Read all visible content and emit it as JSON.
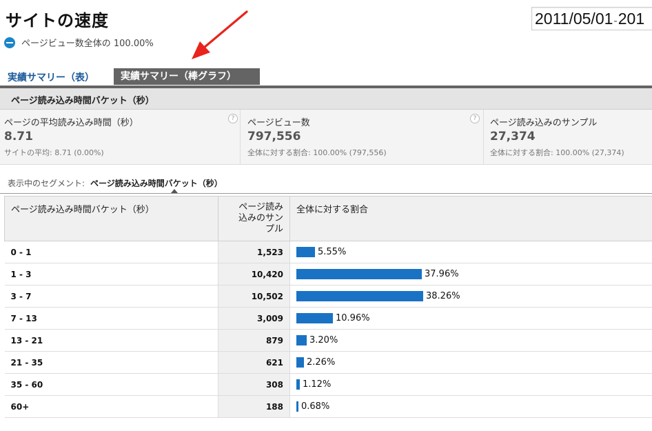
{
  "header": {
    "title": "サイトの速度",
    "date_start": "2011/05/01",
    "date_sep": "-",
    "date_end_partial": "201"
  },
  "pageview_summary": "ページビュー数全体の 100.00%",
  "tabs": [
    {
      "label": "実績サマリー（表）",
      "active": false
    },
    {
      "label": "実績サマリー（棒グラフ）",
      "active": true
    }
  ],
  "dimension_bar": "ページ読み込み時間バケット（秒）",
  "scorecards": [
    {
      "label": "ページの平均読み込み時間（秒）",
      "value": "8.71",
      "sub": "サイトの平均: 8.71 (0.00%)",
      "help": "?"
    },
    {
      "label": "ページビュー数",
      "value": "797,556",
      "sub": "全体に対する割合: 100.00% (797,556)",
      "help": "?"
    },
    {
      "label": "ページ読み込みのサンプル",
      "value": "27,374",
      "sub": "全体に対する割合: 100.00% (27,374)"
    }
  ],
  "segment": {
    "label": "表示中のセグメント:",
    "value": "ページ読み込み時間バケット（秒）"
  },
  "table": {
    "columns": [
      "ページ読み込み時間バケット（秒）",
      "ページ読み込みのサンプル",
      "全体に対する割合"
    ],
    "column_num_lines": [
      "ページ読み",
      "込みのサン",
      "プル"
    ],
    "rows": [
      {
        "bucket": "0 - 1",
        "samples": "1,523",
        "percent": "5.55%",
        "fraction": 0.0555
      },
      {
        "bucket": "1 - 3",
        "samples": "10,420",
        "percent": "37.96%",
        "fraction": 0.3796
      },
      {
        "bucket": "3 - 7",
        "samples": "10,502",
        "percent": "38.26%",
        "fraction": 0.3826
      },
      {
        "bucket": "7 - 13",
        "samples": "3,009",
        "percent": "10.96%",
        "fraction": 0.1096
      },
      {
        "bucket": "13 - 21",
        "samples": "879",
        "percent": "3.20%",
        "fraction": 0.032
      },
      {
        "bucket": "21 - 35",
        "samples": "621",
        "percent": "2.26%",
        "fraction": 0.0226
      },
      {
        "bucket": "35 - 60",
        "samples": "308",
        "percent": "1.12%",
        "fraction": 0.0112
      },
      {
        "bucket": "60+",
        "samples": "188",
        "percent": "0.68%",
        "fraction": 0.0068
      }
    ]
  },
  "colors": {
    "bar": "#1a72c4",
    "active_tab": "#646464",
    "link": "#1a5a9a",
    "annotation_arrow": "#e8241c"
  }
}
